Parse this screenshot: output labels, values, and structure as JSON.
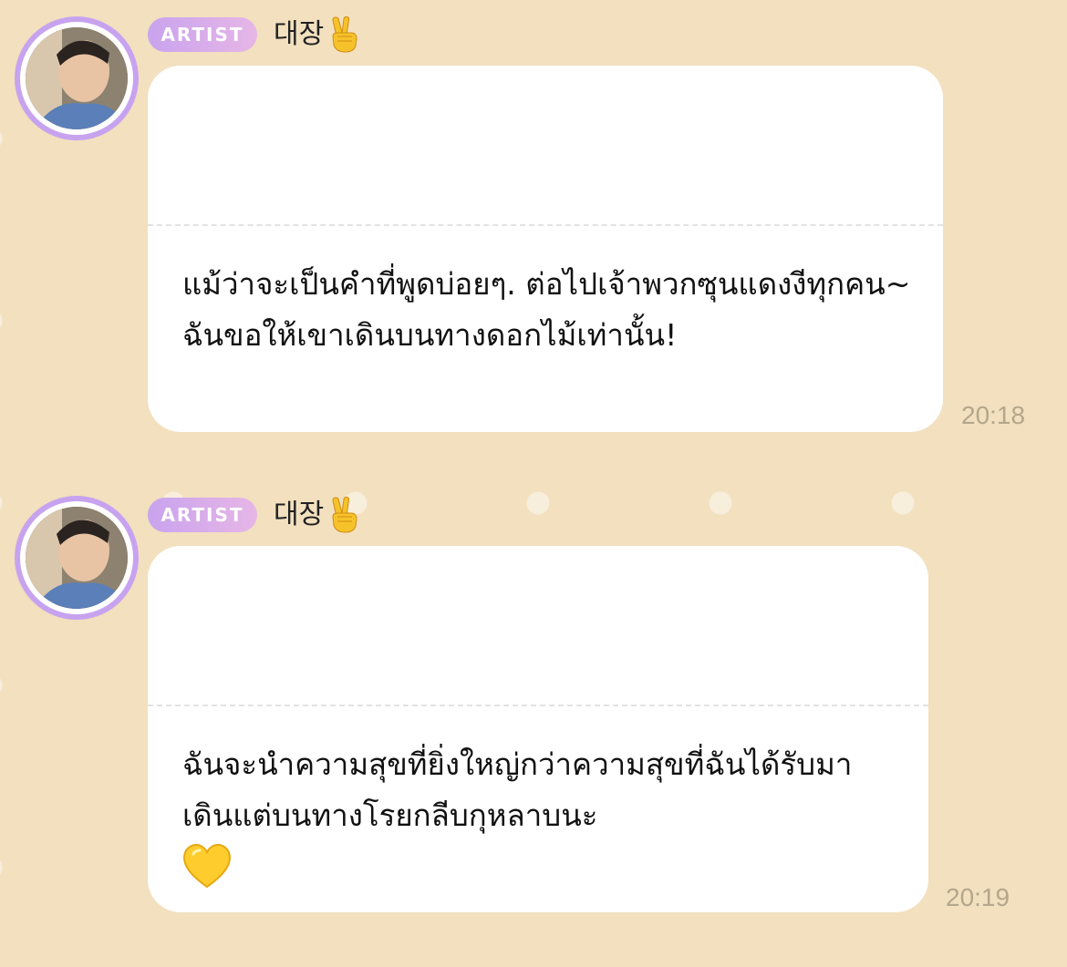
{
  "messages": [
    {
      "badge": "ARTIST",
      "sender": "대장",
      "sender_emoji": "victory-hand-icon",
      "text": "แม้ว่าจะเป็นคำที่พูดบ่อยๆ. ต่อไปเจ้าพวกซุนแดงงีทุกคน~ ฉันขอให้เขาเดินบนทางดอกไม้เท่านั้น!",
      "time": "20:18"
    },
    {
      "badge": "ARTIST",
      "sender": "대장",
      "sender_emoji": "victory-hand-icon",
      "text": "ฉันจะนำความสุขที่ยิ่งใหญ่กว่าความสุขที่ฉันได้รับมา เดินแต่บนทางโรยกลีบกุหลาบนะ",
      "trailing_emoji": "yellow-heart-icon",
      "time": "20:19"
    }
  ],
  "colors": {
    "background": "#f2e0bf",
    "badge_start": "#c9a3ee",
    "badge_end": "#e6b6e6",
    "avatar_ring": "#c7a3ef",
    "time_text": "#b4a78b"
  }
}
